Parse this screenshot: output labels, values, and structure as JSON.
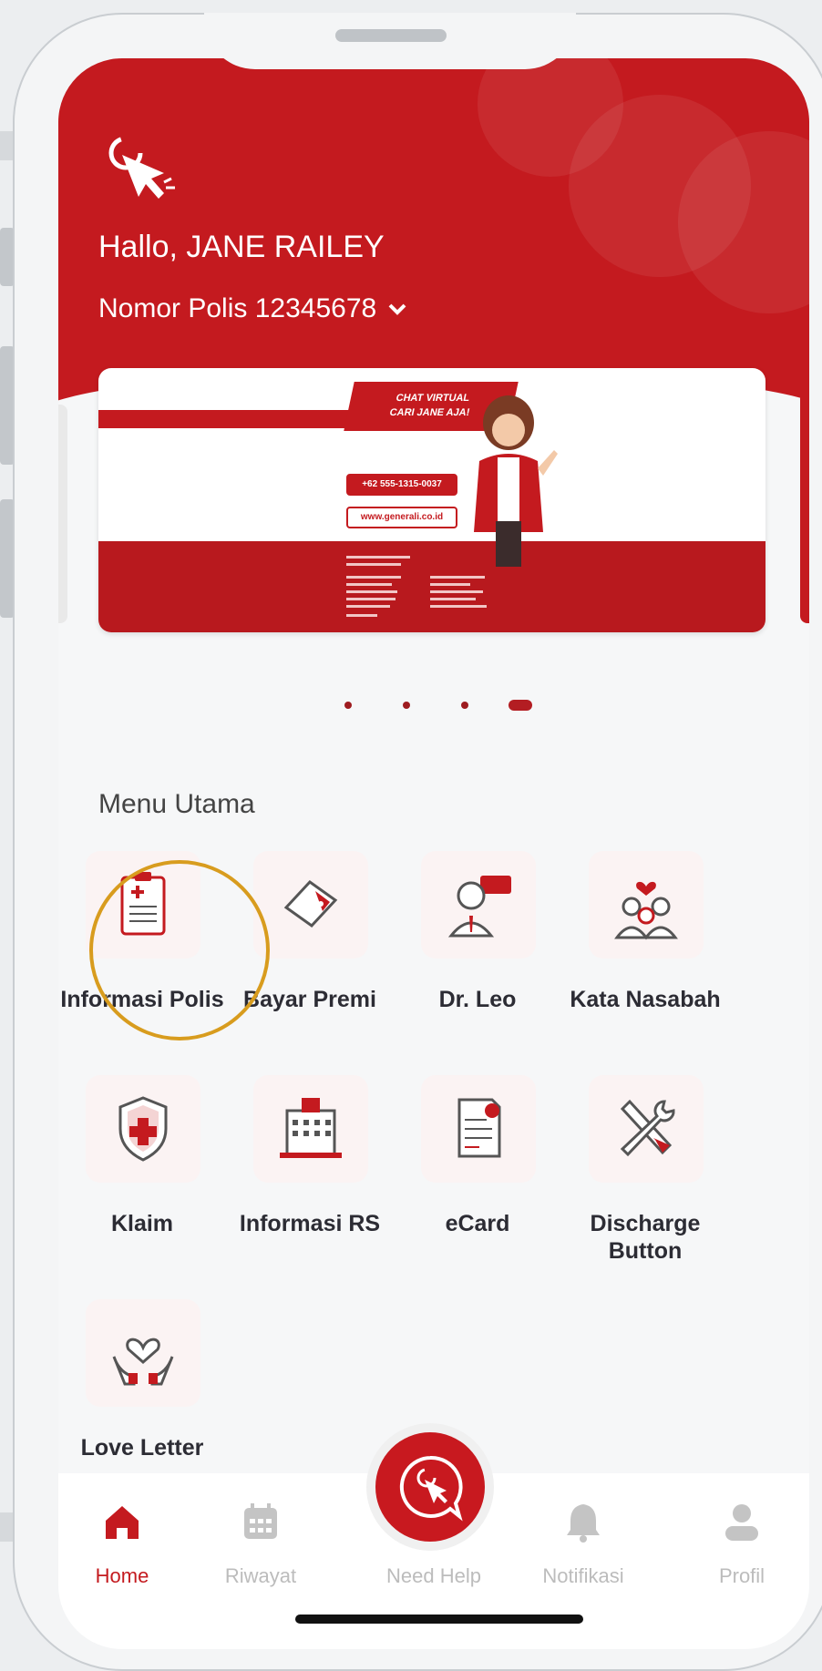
{
  "header": {
    "greeting": "Hallo, JANE RAILEY",
    "policy_label": "Nomor Polis 12345678"
  },
  "banner": {
    "headline_line1": "CHAT VIRTUAL",
    "headline_line2": "CARI JANE AJA!",
    "phone": "+62 555-1315-0037",
    "website": "www.generali.co.id",
    "active_slide": 4,
    "slide_count": 4
  },
  "menu": {
    "title": "Menu Utama",
    "items": [
      {
        "label": "Informasi Polis",
        "icon": "clipboard-medical-icon"
      },
      {
        "label": "Bayar Premi",
        "icon": "wallet-icon"
      },
      {
        "label": "Dr. Leo",
        "icon": "doctor-chat-icon"
      },
      {
        "label": "Kata Nasabah",
        "icon": "family-heart-icon"
      },
      {
        "label": "Klaim",
        "icon": "shield-cross-icon"
      },
      {
        "label": "Informasi RS",
        "icon": "hospital-icon"
      },
      {
        "label": "eCard",
        "icon": "card-document-icon"
      },
      {
        "label": "Discharge Button",
        "icon": "tools-icon"
      },
      {
        "label": "Love Letter",
        "icon": "heart-hands-icon"
      }
    ]
  },
  "nav": {
    "items": [
      {
        "label": "Home",
        "icon": "home-icon",
        "active": true
      },
      {
        "label": "Riwayat",
        "icon": "calendar-icon",
        "active": false
      },
      {
        "label": "Need Help",
        "icon": "chat-help-icon",
        "active": false
      },
      {
        "label": "Notifikasi",
        "icon": "bell-icon",
        "active": false
      },
      {
        "label": "Profil",
        "icon": "user-icon",
        "active": false
      }
    ]
  },
  "colors": {
    "brand_red": "#c41a1f",
    "highlight_ring": "#d89c1e",
    "inactive_nav": "#bcbcbc"
  }
}
